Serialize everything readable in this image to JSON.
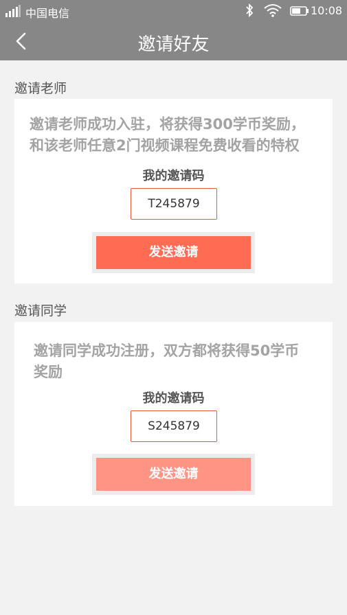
{
  "status_bar": {
    "carrier": "中国电信",
    "time": "10:08",
    "icons": [
      "signal-icon",
      "bluetooth-icon",
      "wifi-icon",
      "battery-icon"
    ]
  },
  "header": {
    "title": "邀请好友",
    "back_icon": "chevron-left-icon"
  },
  "teacher_section": {
    "label": "邀请老师",
    "desc_line1": "邀请老师成功入驻，将获得300学币奖励，",
    "desc_line2": "和该老师任意2门视频课程免费收看的特权",
    "code_label": "我的邀请码",
    "code": "T245879",
    "button_label": "发送邀请",
    "button_color": "#ff6b53"
  },
  "student_section": {
    "label": "邀请同学",
    "desc_line1": "邀请同学成功注册，双方都将获得50学币",
    "desc_line2": "奖励",
    "code_label": "我的邀请码",
    "code": "S245879",
    "button_label": "发送邀请",
    "button_color": "#ff9485"
  },
  "colors": {
    "header_bg": "#878787",
    "page_bg": "#f2f2f2",
    "code_border": "#e9573f"
  }
}
